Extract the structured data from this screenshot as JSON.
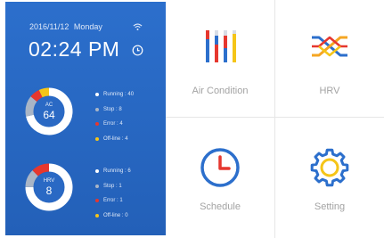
{
  "status_panel": {
    "date": "2016/11/12",
    "weekday": "Monday",
    "time": "02:24 PM",
    "background_color": "#2c6fcc",
    "icons": {
      "wifi": "wifi-icon",
      "clock": "clock-icon"
    }
  },
  "ac_summary": {
    "label": "AC",
    "total": "64",
    "legend": [
      {
        "text": "Running : 40",
        "color": "#ffffff",
        "count": 40
      },
      {
        "text": "Stop : 8",
        "color": "#a9b5c6",
        "count": 8
      },
      {
        "text": "Error : 4",
        "color": "#e6372e",
        "count": 4
      },
      {
        "text": "Off-line : 4",
        "color": "#f5c518",
        "count": 4
      }
    ]
  },
  "hrv_summary": {
    "label": "HRV",
    "total": "8",
    "legend": [
      {
        "text": "Running : 6",
        "color": "#ffffff",
        "count": 6
      },
      {
        "text": "Stop : 1",
        "color": "#a9b5c6",
        "count": 1
      },
      {
        "text": "Error : 1",
        "color": "#e6372e",
        "count": 1
      },
      {
        "text": "Off-line : 0",
        "color": "#f5c518",
        "count": 0
      }
    ]
  },
  "menu": {
    "air_condition": {
      "label": "Air Condition",
      "icon": "air-condition-icon"
    },
    "hrv": {
      "label": "HRV",
      "icon": "hrv-icon"
    },
    "schedule": {
      "label": "Schedule",
      "icon": "schedule-clock-icon"
    },
    "setting": {
      "label": "Setting",
      "icon": "setting-gear-icon"
    }
  },
  "colors": {
    "accent_blue": "#2c6fcc",
    "red": "#e6372e",
    "yellow": "#f5c518",
    "grey": "#a9b5c6",
    "label_grey": "#a3a3a3"
  }
}
